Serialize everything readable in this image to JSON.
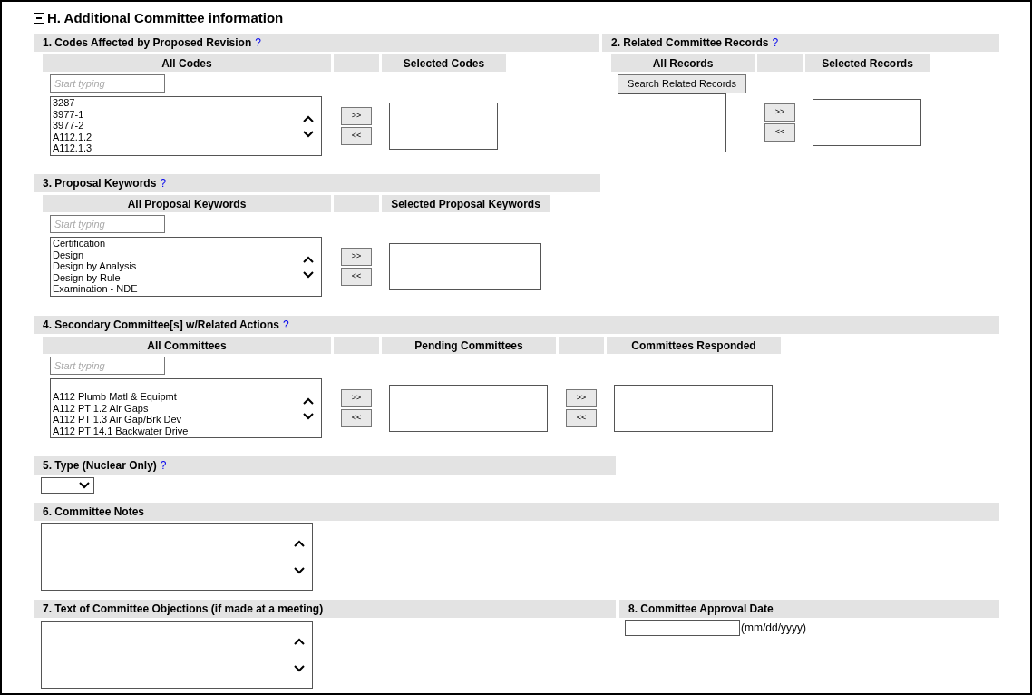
{
  "section": {
    "title": "H. Additional Committee information",
    "expanded": true
  },
  "pickers": [
    {
      "kind": "filter",
      "label": "1. Codes Affected by Proposed Revision",
      "help": "?",
      "source_header": "All Codes",
      "filter": {
        "placeholder": "Start typing"
      },
      "leading_blank": false,
      "options": [
        "3287",
        "3977-1",
        "3977-2",
        "A112.1.2",
        "A112.1.3"
      ],
      "targets": [
        {
          "header": "Selected Codes",
          "buttons": [
            ">>",
            "<<"
          ]
        }
      ]
    },
    {
      "kind": "search",
      "label": "2. Related Committee Records",
      "help": "?",
      "source_header": "All Records",
      "search_button": "Search Related Records",
      "targets": [
        {
          "header": "Selected Records",
          "buttons": [
            ">>",
            "<<"
          ]
        }
      ]
    },
    {
      "kind": "filter",
      "label": "3. Proposal Keywords",
      "help": "?",
      "source_header": "All Proposal Keywords",
      "filter": {
        "placeholder": "Start typing"
      },
      "leading_blank": false,
      "options": [
        "Certification",
        "Design",
        "Design by Analysis",
        "Design by Rule",
        "Examination - NDE"
      ],
      "targets": [
        {
          "header": "Selected Proposal Keywords",
          "buttons": [
            ">>",
            "<<"
          ]
        }
      ]
    },
    {
      "kind": "filter",
      "label": "4. Secondary Committee[s] w/Related Actions",
      "help": "?",
      "source_header": "All Committees",
      "filter": {
        "placeholder": "Start typing"
      },
      "leading_blank": true,
      "options": [
        "A112 Plumb Matl & Equipmt",
        "A112 PT 1.2 Air Gaps",
        "A112 PT 1.3 Air Gap/Brk Dev",
        "A112 PT 14.1 Backwater Drive"
      ],
      "targets": [
        {
          "header": "Pending Committees",
          "buttons": [
            ">>",
            "<<"
          ]
        },
        {
          "header": "Committees Responded",
          "buttons": [
            ">>",
            "<<"
          ]
        }
      ]
    }
  ],
  "type_field": {
    "label": "5. Type (Nuclear Only)",
    "help": "?"
  },
  "notes": {
    "label": "6. Committee Notes"
  },
  "objections": {
    "label": "7. Text of Committee Objections (if made at a meeting)"
  },
  "approval_date": {
    "label": "8. Committee Approval Date",
    "hint": "(mm/dd/yyyy)"
  }
}
